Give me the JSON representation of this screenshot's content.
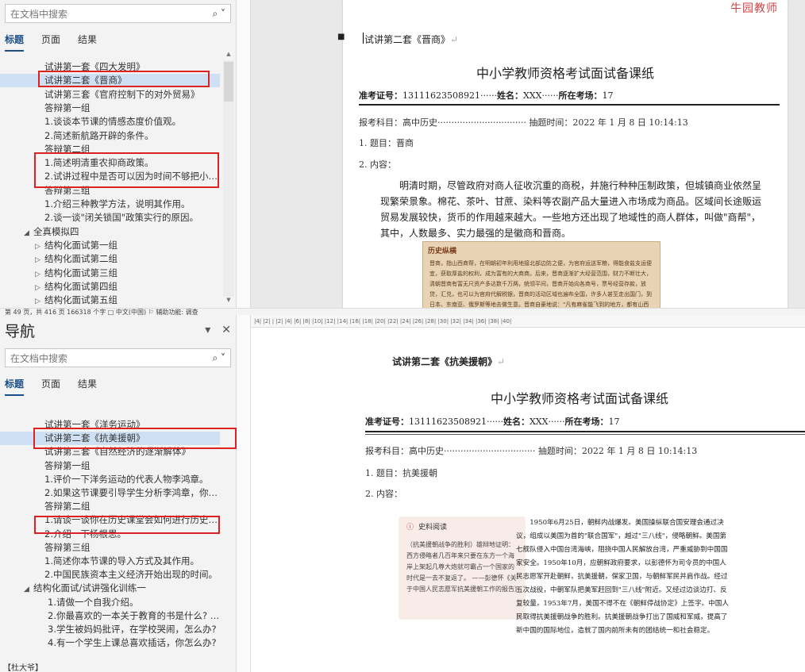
{
  "top": {
    "nav": {
      "search_placeholder": "在文档中搜索",
      "tabs": [
        "标题",
        "页面",
        "结果"
      ],
      "items": [
        {
          "text": "试讲第一套《四大发明》",
          "indent": 1
        },
        {
          "text": "试讲第二套《晋商》",
          "indent": 1,
          "selected": true
        },
        {
          "text": "试讲第三套《官府控制下的对外贸易》",
          "indent": 1
        },
        {
          "text": "答辩第一组",
          "indent": 1
        },
        {
          "text": "1.谈谈本节课的情感态度价值观。",
          "indent": 1
        },
        {
          "text": "2.简述新航路开辟的条件。",
          "indent": 1
        },
        {
          "text": "答辩第二组",
          "indent": 1
        },
        {
          "text": "1.简述明清重农抑商政策。",
          "indent": 1
        },
        {
          "text": "2.试讲过程中是否可以因为时间不够把小结去...",
          "indent": 1
        },
        {
          "text": "答辩第三组",
          "indent": 1
        },
        {
          "text": "1.介绍三种教学方法，说明其作用。",
          "indent": 1
        },
        {
          "text": "2.谈一谈\"闭关锁国\"政策实行的原因。",
          "indent": 1
        },
        {
          "text": "全真模拟四",
          "indent": 0,
          "arrow": "◢"
        },
        {
          "text": "结构化面试第一组",
          "indent": 1,
          "arrow": "▷"
        },
        {
          "text": "结构化面试第二组",
          "indent": 1,
          "arrow": "▷"
        },
        {
          "text": "结构化面试第三组",
          "indent": 1,
          "arrow": "▷"
        },
        {
          "text": "结构化面试第四组",
          "indent": 1,
          "arrow": "▷"
        },
        {
          "text": "结构化面试第五组",
          "indent": 1,
          "arrow": "▷"
        }
      ]
    },
    "doc": {
      "logo": "牛园教师",
      "heading": "试讲第二套《晋商》",
      "title": "中小学教师资格考试面试备课纸",
      "info_label1": "准考证号：",
      "info_val1": "13111623508921",
      "info_label2": "姓名：",
      "info_val2": "XXX",
      "info_label3": "所在考场：",
      "info_val3": "17",
      "subject_line": "报考科目：高中历史",
      "time_line": "抽题时间：2022 年 1 月 8 日 10:14:13",
      "topic": "1. 题目：晋商",
      "content": "2. 内容：",
      "paragraph": "明清时期，尽管政府对商人征收沉重的商税，并施行种种压制政策，但城镇商业依然呈现繁荣景象。棉花、茶叶、甘蔗、染料等农副产品大量进入市场成为商品。区域间长途贩运贸易发展较快，货币的作用越来越大。一些地方还出现了地域性的商人群体，叫做\"商帮\"，其中，人数最多、实力最强的是徽商和晋商。",
      "box_title": "历史纵横",
      "box_text": "晋商，指山西商帮，在明朝初年利用地接北部边防之便，为官府运送军粮，得能食盐支运便宜，获取厚盐的权利，成为富有的大商商。后来，晋商逐渐扩大经营范围，财力不断壮大，清朝晋商有富无尺资产多达数千万两，统领平间，晋商开始向各商号，票号经营存款，放贷，汇兑，也可以为官府代解税银，晋商的活动区域也遍布全国，许多人甚至走出国门，到日本、东南亚、俄罗斯等地去做生意。晋商自豪地说：\"凡有麻雀能飞到的地方，都有山西商人。\""
    },
    "status": "第 49 页，共 416 页   166318 个字   □   中文(中国)   ⚐ 辅助功能: 调查"
  },
  "bottom": {
    "nav": {
      "title": "导航",
      "search_placeholder": "在文档中搜索",
      "tabs": [
        "标题",
        "页面",
        "结果"
      ],
      "items": [
        {
          "text": "试讲第一套《洋务运动》",
          "indent": 1
        },
        {
          "text": "试讲第二套《抗美援朝》",
          "indent": 1,
          "selected": true
        },
        {
          "text": "试讲第三套《自然经济的逐渐解体》",
          "indent": 1
        },
        {
          "text": "答辩第一组",
          "indent": 1
        },
        {
          "text": "1.评价一下洋务运动的代表人物李鸿章。",
          "indent": 1
        },
        {
          "text": "2.如果这节课要引导学生分析李鸿章，你会如...",
          "indent": 1
        },
        {
          "text": "答辩第二组",
          "indent": 1
        },
        {
          "text": "1.请谈一谈你在历史课堂会如何进行历史分解...",
          "indent": 1
        },
        {
          "text": "2.介绍一下杨根思。",
          "indent": 1
        },
        {
          "text": "答辩第三组",
          "indent": 1
        },
        {
          "text": "1.简述你本节课的导入方式及其作用。",
          "indent": 1
        },
        {
          "text": "2.中国民族资本主义经济开始出现的时间。",
          "indent": 1
        },
        {
          "text": "结构化面试/试讲强化训练一",
          "indent": 0,
          "arrow": "◢"
        },
        {
          "text": "1.请做一个自我介绍。",
          "indent": 2
        },
        {
          "text": "2.你最喜欢的一本关于教育的书是什么? 对...",
          "indent": 2
        },
        {
          "text": "3.学生被妈妈批评，在学校哭闹，怎么办?",
          "indent": 2
        },
        {
          "text": "4.有一个学生上课总喜欢插话，你怎么办?",
          "indent": 2
        }
      ],
      "footer": "【杜大爷】"
    },
    "ruler_ticks": "|4|  |2|  |   |2|   |4|   |6|   |8|   |10|   |12|   |14|   |16|   |18|   |20|   |22|   |24|   |26|   |28|   |30|   |32|   |34|   |36|   |38|   |40|",
    "doc": {
      "heading": "试讲第二套《抗美援朝》",
      "title": "中小学教师资格考试面试备课纸",
      "info_label1": "准考证号：",
      "info_val1": "13111623508921",
      "info_label2": "姓名：",
      "info_val2": "XXX",
      "info_label3": "所在考场：",
      "info_val3": "17",
      "subject_line": "报考科目：高中历史",
      "time_line": "抽题时间：2022 年 1 月 8 日 10:14:13",
      "topic": "1. 题目：抗美援朝",
      "content": "2. 内容：",
      "side_title": "史料阅读",
      "side_text": "（抗美援朝战争的胜利）雄辩地证明：西方侵略者几百年来只要在东方一个海岸上架起几尊大炮就可霸占一个国家的时代是一去不复返了。 ——彭德怀《关于中国人民志愿军抗美援朝工作的报告》",
      "essay": "1950年6月25日，朝鲜内战爆发。美国操纵联合国安理会通过决议，组成以美国为首的\"联合国军\"，越过\"三八线\"，侵略朝鲜。美国第七舰队侵入中国台湾海峡，阻挠中国人民解放台湾，严重威胁到中国国家安全。1950年10月，应朝鲜政府要求，以彭德怀为司令员的中国人民志愿军开赴朝鲜，抗美援朝，保家卫国，与朝鲜军民并肩作战。经过五次战役，中朝军队把美军赶回到\"三八线\"附近。又经过边谈边打、反复较量，1953年7月，美国不得不在《朝鲜停战协定》上签字。中国人民取得抗美援朝战争的胜利。抗美援朝战争打出了国威和军威，提高了新中国的国际地位，造就了国内前所未有的团结统一和社会稳定。"
    }
  }
}
